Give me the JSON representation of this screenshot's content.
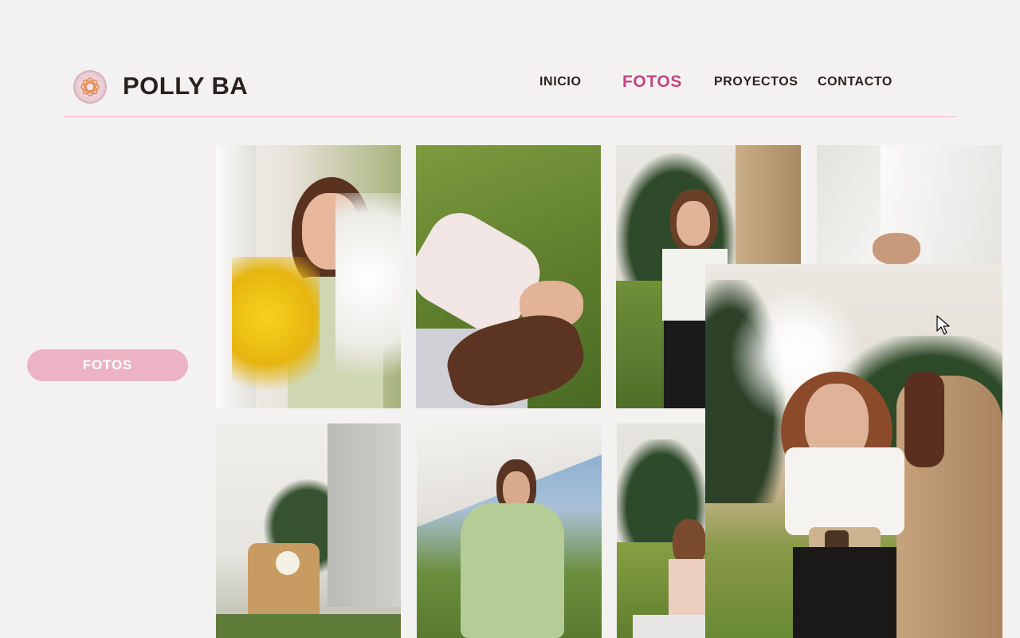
{
  "header": {
    "brand": "POLLY BA",
    "logo_icon": "flower-icon",
    "nav": [
      {
        "label": "INICIO",
        "active": false
      },
      {
        "label": "FOTOS",
        "active": true
      },
      {
        "label": "PROYECTOS",
        "active": false
      },
      {
        "label": "CONTACTO",
        "active": false
      }
    ]
  },
  "sidebar": {
    "button_label": "FOTOS"
  },
  "gallery": {
    "photos": [
      {
        "name": "photo-woman-yellow-flowers"
      },
      {
        "name": "photo-woman-lying-grass"
      },
      {
        "name": "photo-woman-with-horse"
      },
      {
        "name": "photo-woman-white-curtain"
      },
      {
        "name": "photo-straw-bag-hat"
      },
      {
        "name": "photo-woman-green-dress-crouching"
      },
      {
        "name": "photo-woman-sitting-field"
      }
    ],
    "preview": {
      "name": "photo-preview-woman-horse-sunset"
    }
  },
  "colors": {
    "background": "#f4f2f0",
    "accent": "#c0467f",
    "pill": "#ecb3c5",
    "divider": "#eab2c3"
  },
  "cursor_icon": "arrow-cursor-icon"
}
